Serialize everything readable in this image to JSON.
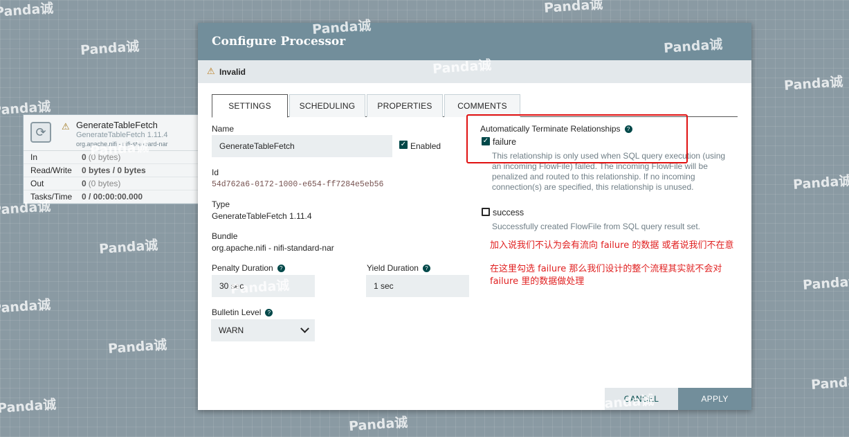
{
  "processor_card": {
    "name": "GenerateTableFetch",
    "version": "GenerateTableFetch 1.11.4",
    "bundle": "org.apache.nifi - nifi-standard-nar",
    "rows": [
      {
        "label": "In",
        "value": "0",
        "extra": "(0 bytes)"
      },
      {
        "label": "Read/Write",
        "value": "0 bytes / 0 bytes",
        "extra": ""
      },
      {
        "label": "Out",
        "value": "0",
        "extra": "(0 bytes)"
      },
      {
        "label": "Tasks/Time",
        "value": "0 / 00:00:00.000",
        "extra": ""
      }
    ]
  },
  "dialog": {
    "title": "Configure Processor",
    "status": "Invalid",
    "tabs": [
      "SETTINGS",
      "SCHEDULING",
      "PROPERTIES",
      "COMMENTS"
    ],
    "settings": {
      "name_label": "Name",
      "name_value": "GenerateTableFetch",
      "enabled_label": "Enabled",
      "id_label": "Id",
      "id_value": "54d762a6-0172-1000-e654-ff7284e5eb56",
      "type_label": "Type",
      "type_value": "GenerateTableFetch 1.11.4",
      "bundle_label": "Bundle",
      "bundle_value": "org.apache.nifi - nifi-standard-nar",
      "penalty_label": "Penalty Duration",
      "penalty_value": "30 sec",
      "yield_label": "Yield Duration",
      "yield_value": "1 sec",
      "bulletin_label": "Bulletin Level",
      "bulletin_value": "WARN"
    },
    "relationships": {
      "label": "Automatically Terminate Relationships",
      "items": [
        {
          "name": "failure",
          "checked": true,
          "description": "This relationship is only used when SQL query execution (using an incoming FlowFile) failed. The incoming FlowFile will be penalized and routed to this relationship. If no incoming connection(s) are specified, this relationship is unused."
        },
        {
          "name": "success",
          "checked": false,
          "description": "Successfully created FlowFile from SQL query result set."
        }
      ]
    },
    "annotations": [
      "加入说我们不认为会有流向 failure 的数据 或者说我们不在意",
      "在这里勾选 failure  那么我们设计的整个流程其实就不会对",
      "failure 里的数据做处理"
    ],
    "buttons": {
      "cancel": "CANCEL",
      "apply": "APPLY"
    }
  },
  "watermarks": [
    "Panda诚"
  ]
}
